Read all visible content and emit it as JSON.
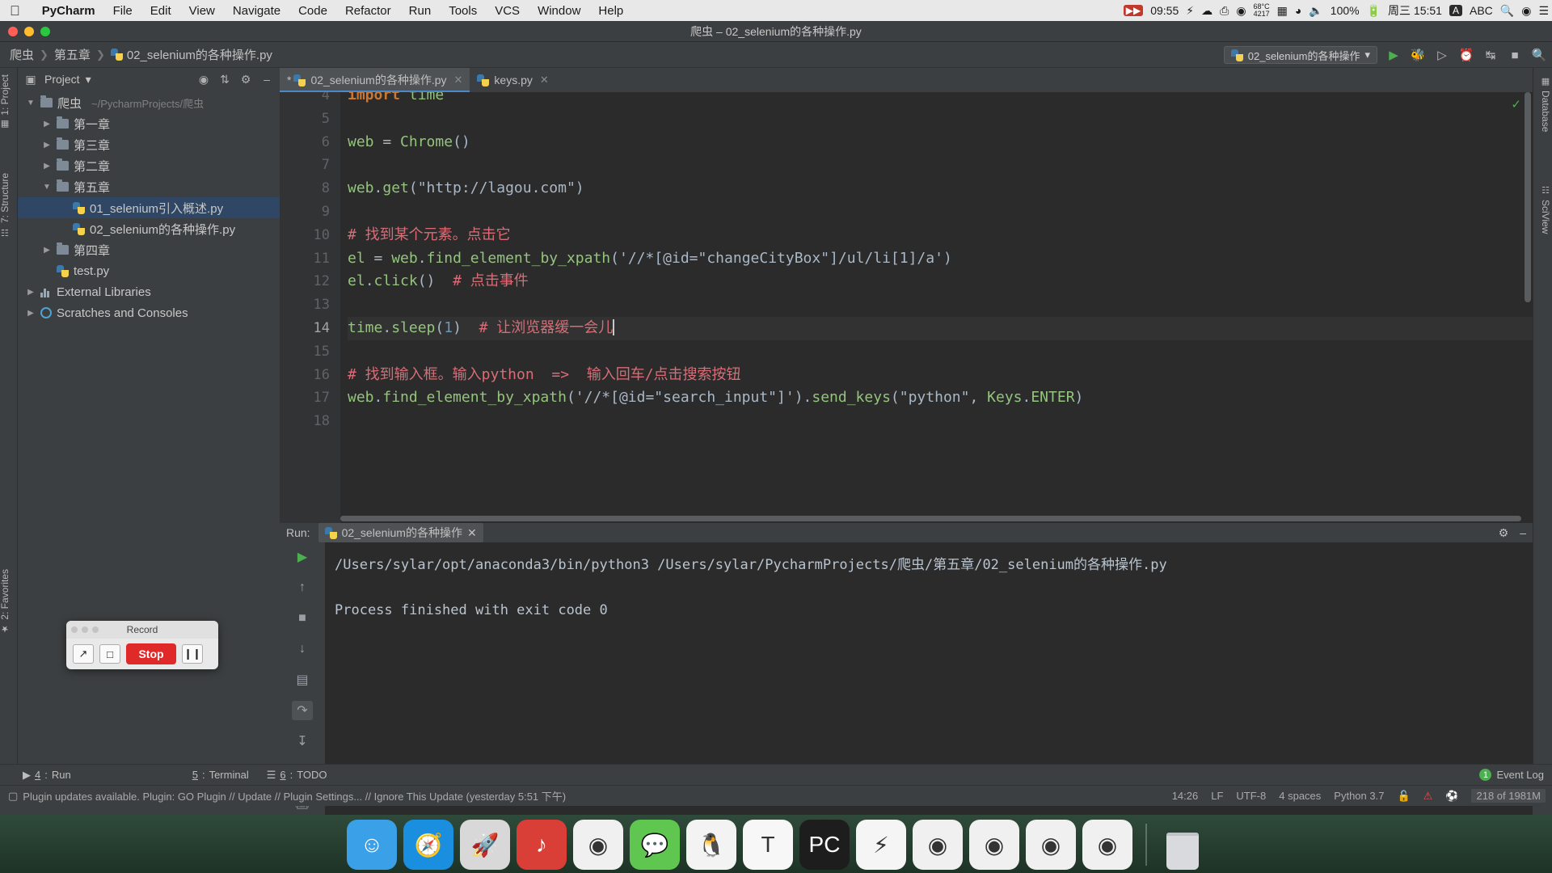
{
  "macos_menubar": {
    "apple_icon": "apple-icon",
    "app_name": "PyCharm",
    "menus": [
      "File",
      "Edit",
      "View",
      "Navigate",
      "Code",
      "Refactor",
      "Run",
      "Tools",
      "VCS",
      "Window",
      "Help"
    ],
    "right_status": {
      "screen_record_time": "09:55",
      "bolt_icon": "bolt-icon",
      "cloud_icon": "cloud-sync-icon",
      "clipboard_icon": "clipboard-icon",
      "color_icon": "color-wheel-icon",
      "temperature": "68°C",
      "fan_speed": "4217",
      "battery_meter_icon": "battery-meter-icon",
      "wifi_icon": "wifi-icon",
      "volume_icon": "volume-icon",
      "battery_percent": "100%",
      "battery_icon": "battery-charging-icon",
      "date_time": "周三 15:51",
      "input_source_badge": "A",
      "input_source": "ABC",
      "search_icon": "spotlight-search-icon",
      "siri_icon": "siri-icon",
      "control_center_icon": "notification-center-icon"
    }
  },
  "window": {
    "title": "爬虫 – 02_selenium的各种操作.py",
    "traffic_lights": [
      "close",
      "minimize",
      "zoom"
    ]
  },
  "navbar": {
    "breadcrumbs": [
      "爬虫",
      "第五章",
      "02_selenium的各种操作.py"
    ],
    "run_config": "02_selenium的各种操作",
    "icons": [
      "run-icon",
      "debug-icon",
      "coverage-icon",
      "profile-icon",
      "attach-icon",
      "stop-icon",
      "search-everywhere-icon"
    ]
  },
  "left_rail": {
    "items": [
      {
        "label": "1: Project",
        "icon": "project-icon"
      },
      {
        "label": "7: Structure",
        "icon": "structure-icon"
      },
      {
        "label": "2: Favorites",
        "icon": "favorites-star-icon"
      }
    ]
  },
  "right_rail": {
    "items": [
      {
        "label": "Database",
        "icon": "database-icon"
      },
      {
        "label": "SciView",
        "icon": "sciview-icon"
      }
    ]
  },
  "project_panel": {
    "title": "Project",
    "header_icons": [
      "locate-icon",
      "collapse-all-icon",
      "settings-gear-icon",
      "hide-icon"
    ],
    "tree": [
      {
        "depth": 0,
        "arrow": "expanded",
        "icon": "folder-icon",
        "label": "爬虫",
        "path": "~/PycharmProjects/爬虫",
        "selected": false
      },
      {
        "depth": 1,
        "arrow": "collapsed",
        "icon": "folder-icon",
        "label": "第一章",
        "path": "",
        "selected": false
      },
      {
        "depth": 1,
        "arrow": "collapsed",
        "icon": "folder-icon",
        "label": "第三章",
        "path": "",
        "selected": false
      },
      {
        "depth": 1,
        "arrow": "collapsed",
        "icon": "folder-icon",
        "label": "第二章",
        "path": "",
        "selected": false
      },
      {
        "depth": 1,
        "arrow": "expanded",
        "icon": "folder-icon",
        "label": "第五章",
        "path": "",
        "selected": false
      },
      {
        "depth": 2,
        "arrow": "none",
        "icon": "python-file-icon",
        "label": "01_selenium引入概述.py",
        "path": "",
        "selected": true
      },
      {
        "depth": 2,
        "arrow": "none",
        "icon": "python-file-icon",
        "label": "02_selenium的各种操作.py",
        "path": "",
        "selected": false
      },
      {
        "depth": 1,
        "arrow": "collapsed",
        "icon": "folder-icon",
        "label": "第四章",
        "path": "",
        "selected": false
      },
      {
        "depth": 1,
        "arrow": "none",
        "icon": "python-file-icon",
        "label": "test.py",
        "path": "",
        "selected": false
      },
      {
        "depth": 0,
        "arrow": "collapsed",
        "icon": "external-libraries-icon",
        "label": "External Libraries",
        "path": "",
        "selected": false
      },
      {
        "depth": 0,
        "arrow": "collapsed",
        "icon": "scratches-icon",
        "label": "Scratches and Consoles",
        "path": "",
        "selected": false
      }
    ]
  },
  "editor": {
    "tabs": [
      {
        "label": "02_selenium的各种操作.py",
        "modified": "*",
        "active": true,
        "icon": "python-file-icon"
      },
      {
        "label": "keys.py",
        "modified": "",
        "active": false,
        "icon": "python-file-icon"
      }
    ],
    "first_visible_line": 4,
    "current_line": 14,
    "lines": [
      {
        "no": "4",
        "text": "import time"
      },
      {
        "no": "5",
        "text": ""
      },
      {
        "no": "6",
        "text": "web = Chrome()"
      },
      {
        "no": "7",
        "text": ""
      },
      {
        "no": "8",
        "text": "web.get(\"http://lagou.com\")"
      },
      {
        "no": "9",
        "text": ""
      },
      {
        "no": "10",
        "text": "# 找到某个元素。点击它"
      },
      {
        "no": "11",
        "text": "el = web.find_element_by_xpath('//*[@id=\"changeCityBox\"]/ul/li[1]/a')"
      },
      {
        "no": "12",
        "text": "el.click()  # 点击事件"
      },
      {
        "no": "13",
        "text": ""
      },
      {
        "no": "14",
        "text": "time.sleep(1)  # 让浏览器缓一会儿"
      },
      {
        "no": "15",
        "text": ""
      },
      {
        "no": "16",
        "text": "# 找到输入框。输入python  =>  输入回车/点击搜索按钮"
      },
      {
        "no": "17",
        "text": "web.find_element_by_xpath('//*[@id=\"search_input\"]').send_keys(\"python\", Keys.ENTER)"
      },
      {
        "no": "18",
        "text": ""
      }
    ],
    "inspection_status": "ok-check-icon"
  },
  "run_panel": {
    "label": "Run:",
    "tab_label": "02_selenium的各种操作",
    "console_lines": [
      "/Users/sylar/opt/anaconda3/bin/python3 /Users/sylar/PycharmProjects/爬虫/第五章/02_selenium的各种操作.py",
      "",
      "Process finished with exit code 0"
    ],
    "side_icons": [
      "rerun-icon",
      "scroll-up-icon",
      "stop-icon",
      "scroll-down-icon",
      "print-icon",
      "soft-wrap-icon",
      "scroll-end-icon",
      "pin-icon",
      "print2-icon",
      "trash-icon"
    ],
    "header_right_icons": [
      "settings-gear-icon",
      "hide-icon"
    ]
  },
  "tool_window_bar": {
    "items": [
      {
        "num": "4",
        "label": "Run"
      },
      {
        "num": "5",
        "label": "Terminal"
      },
      {
        "num": "6",
        "label": "TODO"
      }
    ],
    "event_log": {
      "count": "1",
      "label": "Event Log"
    }
  },
  "statusbar": {
    "notification": "Plugin updates available. Plugin: GO Plugin // Update // Plugin Settings... // Ignore This Update (yesterday 5:51 下午)",
    "caret_position": "14:26",
    "line_separator": "LF",
    "encoding": "UTF-8",
    "indent": "4 spaces",
    "interpreter": "Python 3.7",
    "lock_icon": "unlocked-icon",
    "error_icon": "inspection-error-icon",
    "hector_icon": "hector-icon",
    "memory": "218 of 1981M"
  },
  "record_widget": {
    "title": "Record",
    "arrow_button_icon": "arrow-pointer-icon",
    "square_button_icon": "square-selection-icon",
    "stop_label": "Stop",
    "pause_icon": "pause-icon"
  },
  "dock": {
    "apps": [
      {
        "name": "finder-icon",
        "color": "#3aa0e8",
        "glyph": "☺"
      },
      {
        "name": "safari-icon",
        "color": "#1a8fe0",
        "glyph": "🧭"
      },
      {
        "name": "launchpad-icon",
        "color": "#d8d8d8",
        "glyph": "🚀"
      },
      {
        "name": "netease-music-icon",
        "color": "#d93f36",
        "glyph": "♪"
      },
      {
        "name": "chrome-icon",
        "color": "#f0f0f0",
        "glyph": "◉"
      },
      {
        "name": "wechat-icon",
        "color": "#5fc64f",
        "glyph": "💬"
      },
      {
        "name": "qq-icon",
        "color": "#f3f3f3",
        "glyph": "🐧"
      },
      {
        "name": "typora-icon",
        "color": "#f7f7f7",
        "glyph": "T"
      },
      {
        "name": "pycharm-icon",
        "color": "#1d1d1d",
        "glyph": "PC"
      },
      {
        "name": "thunder-icon",
        "color": "#f5f5f5",
        "glyph": "⚡"
      },
      {
        "name": "chrome-window-1-icon",
        "color": "#f0f0f0",
        "glyph": "◉"
      },
      {
        "name": "chrome-window-2-icon",
        "color": "#f0f0f0",
        "glyph": "◉"
      },
      {
        "name": "chrome-window-3-icon",
        "color": "#f0f0f0",
        "glyph": "◉"
      },
      {
        "name": "chrome-window-4-icon",
        "color": "#f0f0f0",
        "glyph": "◉"
      }
    ],
    "trash_icon": "trash-icon"
  },
  "colors": {
    "ide_bg": "#3c3f41",
    "editor_bg": "#2b2b2b",
    "accent_blue": "#4a88c7",
    "selection": "#2f4764",
    "string_green": "#6a8759",
    "comment_red": "#d96d77",
    "keyword_orange": "#cc7832",
    "number_blue": "#6897bb"
  }
}
